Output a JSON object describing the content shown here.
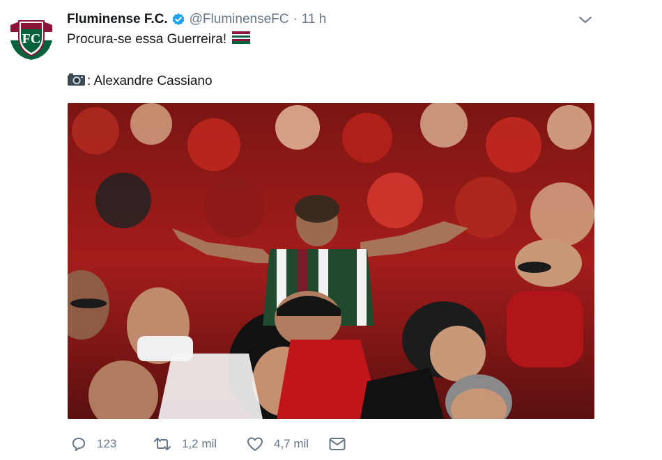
{
  "tweet": {
    "display_name": "Fluminense F.C.",
    "handle": "@FluminenseFC",
    "separator": "·",
    "time": "11 h",
    "text_line1": "Procura-se essa Guerreira!",
    "text_line2": ": Alexandre Cassiano",
    "flag_icon": "fluminense-flag-icon",
    "camera_icon": "camera-icon"
  },
  "actions": {
    "reply_count": "123",
    "retweet_count": "1,2 mil",
    "like_count": "4,7 mil"
  },
  "colors": {
    "accent": "#1da1f2",
    "muted": "#657786",
    "text": "#14171a",
    "club_maroon": "#8a1538",
    "club_green": "#00613c",
    "flamengo_red": "#c8102e"
  }
}
